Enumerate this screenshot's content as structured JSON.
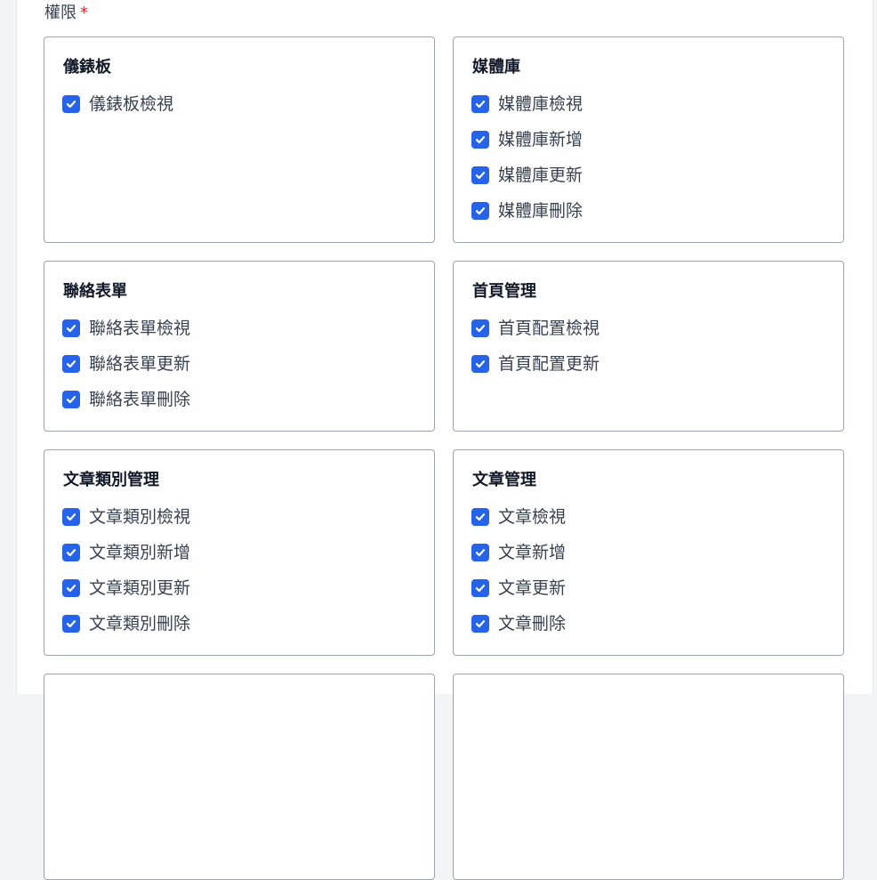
{
  "field": {
    "label": "權限",
    "required_mark": "*"
  },
  "groups": [
    {
      "title": "儀錶板",
      "options": [
        {
          "label": "儀錶板檢視",
          "checked": true
        }
      ]
    },
    {
      "title": "媒體庫",
      "options": [
        {
          "label": "媒體庫檢視",
          "checked": true
        },
        {
          "label": "媒體庫新增",
          "checked": true
        },
        {
          "label": "媒體庫更新",
          "checked": true
        },
        {
          "label": "媒體庫刪除",
          "checked": true
        }
      ]
    },
    {
      "title": "聯絡表單",
      "options": [
        {
          "label": "聯絡表單檢視",
          "checked": true
        },
        {
          "label": "聯絡表單更新",
          "checked": true
        },
        {
          "label": "聯絡表單刪除",
          "checked": true
        }
      ]
    },
    {
      "title": "首頁管理",
      "options": [
        {
          "label": "首頁配置檢視",
          "checked": true
        },
        {
          "label": "首頁配置更新",
          "checked": true
        }
      ]
    },
    {
      "title": "文章類別管理",
      "options": [
        {
          "label": "文章類別檢視",
          "checked": true
        },
        {
          "label": "文章類別新增",
          "checked": true
        },
        {
          "label": "文章類別更新",
          "checked": true
        },
        {
          "label": "文章類別刪除",
          "checked": true
        }
      ]
    },
    {
      "title": "文章管理",
      "options": [
        {
          "label": "文章檢視",
          "checked": true
        },
        {
          "label": "文章新增",
          "checked": true
        },
        {
          "label": "文章更新",
          "checked": true
        },
        {
          "label": "文章刪除",
          "checked": true
        }
      ]
    },
    {
      "title": "",
      "options": []
    },
    {
      "title": "",
      "options": []
    }
  ],
  "colors": {
    "checkbox_fill": "#2563eb",
    "required": "#dc2626",
    "card_border": "#9ca3af"
  },
  "icons": {
    "checkbox": "checkmark-icon"
  }
}
